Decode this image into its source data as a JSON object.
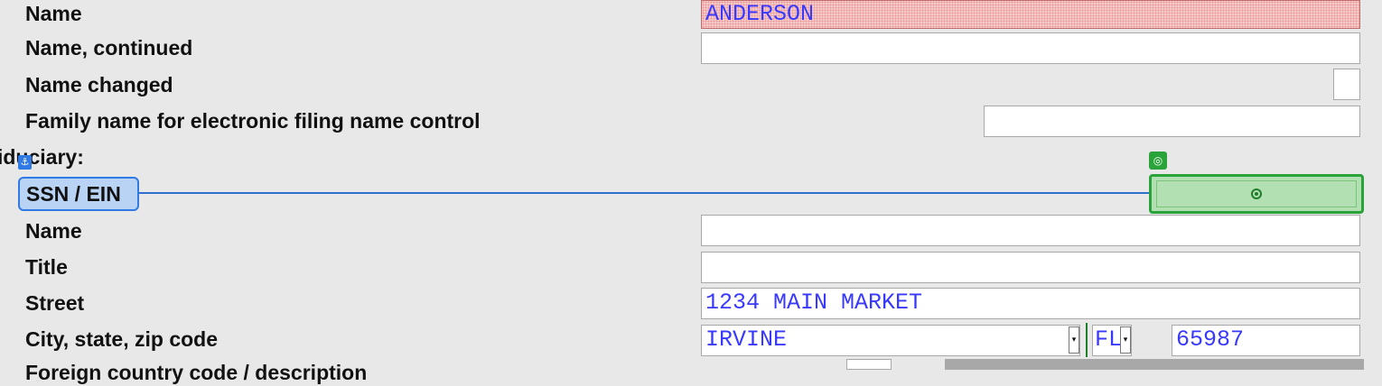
{
  "labels": {
    "name": "Name",
    "name_continued": "Name, continued",
    "name_changed": "Name changed",
    "family_name": "Family name for electronic filing name control",
    "fiduciary_header": "iduciary:",
    "ssn_ein": "SSN / EIN",
    "fid_name": "Name",
    "title": "Title",
    "street": "Street",
    "city_state_zip": "City, state, zip code",
    "partial_next": "Foreign country code / description"
  },
  "fields": {
    "name": "ANDERSON",
    "name_continued": "",
    "name_changed": "",
    "family_name": "",
    "ssn_ein": "",
    "fid_name": "",
    "title": "",
    "street": "1234 MAIN MARKET",
    "city": "IRVINE",
    "state": "FL",
    "zip": "65987"
  },
  "icons": {
    "anchor": "⚓",
    "target": "◎",
    "dropdown": "▾"
  },
  "colors": {
    "anchor_blue": "#2f7ae5",
    "target_green": "#2aa33a",
    "field_text": "#3838ff",
    "error_fill": "#f6c9c9"
  }
}
